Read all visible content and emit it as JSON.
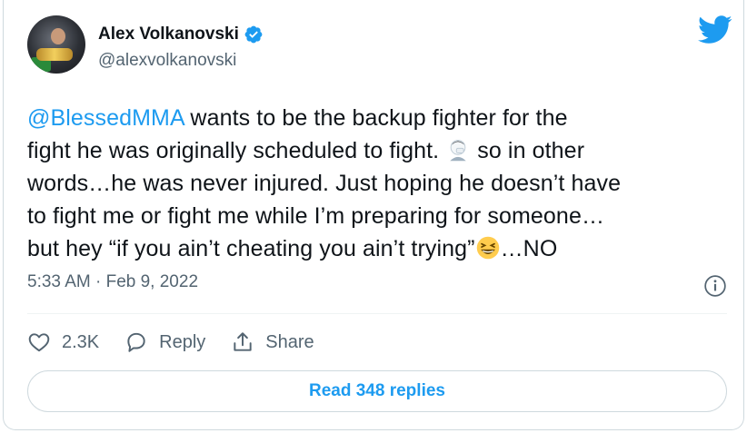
{
  "author": {
    "name": "Alex Volkanovski",
    "handle": "@alexvolkanovski"
  },
  "tweet": {
    "mention": "@BlessedMMA",
    "line1_rest": " wants to be the backup fighter for the",
    "line2_a": "fight he was originally scheduled to fight.",
    "line2_b": " so in other",
    "line3": "words…he was never injured. Just hoping he doesn’t have",
    "line4": "to fight me or fight me while I’m preparing for someone…",
    "line5_a": "but hey “if you ain’t cheating you ain’t trying”",
    "line5_b": "…NO",
    "emoji_1": "person-facepalming-emoji",
    "emoji_2": "grinning-squinting-face-emoji"
  },
  "meta": {
    "timestamp": "5:33 AM · Feb 9, 2022"
  },
  "actions": {
    "likes": "2.3K",
    "reply_label": "Reply",
    "share_label": "Share"
  },
  "replies_button": "Read 348 replies",
  "colors": {
    "accent": "#1d9bf0",
    "text": "#0f1419",
    "muted": "#536471",
    "border": "#cfd9de"
  },
  "icons": [
    "twitter-bird-icon",
    "verified-badge-icon",
    "info-icon",
    "heart-icon",
    "reply-icon",
    "share-icon"
  ]
}
